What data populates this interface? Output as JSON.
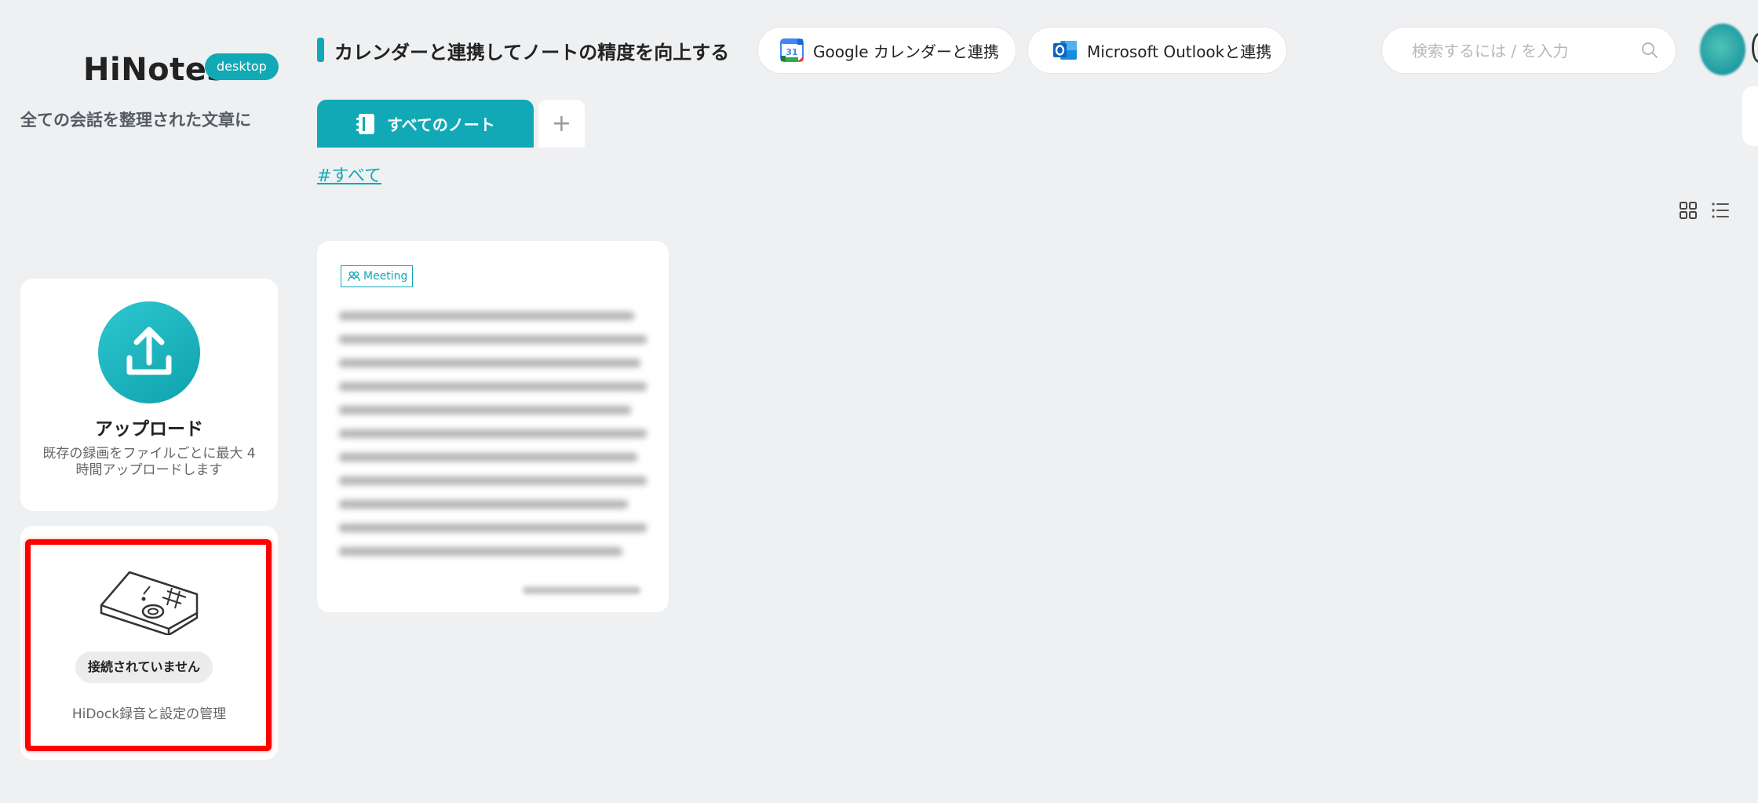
{
  "sidebar": {
    "brand": "HiNotes",
    "badge": "desktop",
    "tagline": "全ての会話を整理された文章に",
    "upload": {
      "title": "アップロード",
      "description": "既存の録画をファイルごとに最大 4 時間アップロードします",
      "icon": "upload-icon"
    },
    "device": {
      "status": "接続されていません",
      "description": "HiDock録音と設定の管理",
      "icon": "hidock-device-icon"
    }
  },
  "header": {
    "calendar_prompt": "カレンダーと連携してノートの精度を向上する",
    "google_button": "Google カレンダーと連携",
    "outlook_button": "Microsoft Outlookと連携",
    "search_placeholder": "検索するには / を入力"
  },
  "tabs": {
    "active_label": "すべてのノート",
    "add_label": "+"
  },
  "filter": {
    "hashtag": "#すべて"
  },
  "notes": [
    {
      "tag": "Meeting"
    }
  ],
  "colors": {
    "accent": "#12a9b6",
    "highlight_border": "#ff0000",
    "background": "#eef0f2"
  }
}
